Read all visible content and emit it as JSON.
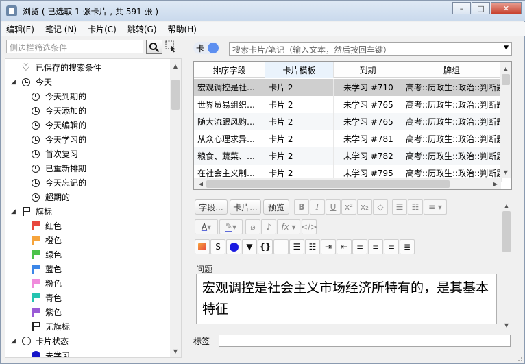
{
  "window": {
    "title": "浏览 ( 已选取 1 张卡片 , 共 591 张 )",
    "minimize_glyph": "–",
    "maximize_glyph": "□",
    "close_glyph": "✕"
  },
  "menu": [
    "编辑(E)",
    "笔记 (N)",
    "卡片(C)",
    "跳转(G)",
    "帮助(H)"
  ],
  "sidebar": {
    "search_placeholder": "侧边栏筛选条件",
    "saved_searches": "已保存的搜索条件",
    "today": {
      "label": "今天",
      "items": [
        "今天到期的",
        "今天添加的",
        "今天编辑的",
        "今天学习的",
        "首次复习",
        "已重新排期",
        "今天忘记的",
        "超期的"
      ]
    },
    "flags": {
      "label": "旗标",
      "items": [
        {
          "label": "红色",
          "color": "#e8473e"
        },
        {
          "label": "橙色",
          "color": "#f6a43c"
        },
        {
          "label": "绿色",
          "color": "#4cc24a"
        },
        {
          "label": "蓝色",
          "color": "#3c87e8"
        },
        {
          "label": "粉色",
          "color": "#f08cdc"
        },
        {
          "label": "青色",
          "color": "#25c4b0"
        },
        {
          "label": "紫色",
          "color": "#9a5bd6"
        },
        {
          "label": "无旗标",
          "color": "none"
        }
      ]
    },
    "card_state": {
      "label": "卡片状态",
      "items": [
        "未学习"
      ]
    }
  },
  "search": {
    "toggle_label": "卡",
    "placeholder": "搜索卡片/笔记（输入文本，然后按回车键）"
  },
  "table": {
    "columns": [
      "排序字段",
      "卡片模板",
      "到期",
      "牌组"
    ],
    "sorted_column": "卡片模板",
    "rows": [
      [
        "宏观调控是社…",
        "卡片 2",
        "未学习 #710",
        "高考::历政生::政治::判断题…"
      ],
      [
        "世界贸易组织…",
        "卡片 2",
        "未学习 #765",
        "高考::历政生::政治::判断题…"
      ],
      [
        "随大流跟风购…",
        "卡片 2",
        "未学习 #765",
        "高考::历政生::政治::判断题…"
      ],
      [
        "从众心理求异…",
        "卡片 2",
        "未学习 #781",
        "高考::历政生::政治::判断题…"
      ],
      [
        "粮食、蔬菜、…",
        "卡片 2",
        "未学习 #782",
        "高考::历政生::政治::判断题…"
      ],
      [
        "在社会主义制…",
        "卡片 2",
        "未学习 #795",
        "高考::历政生::政治::判断题…"
      ]
    ],
    "selected_row": 0
  },
  "editor": {
    "fields_button": "字段...",
    "cards_button": "卡片...",
    "preview_button": "预览",
    "field_name": "问题",
    "field_value": "宏观调控是社会主义市场经济所特有的，是其基本特征",
    "tags_label": "标签",
    "tags_value": ""
  }
}
